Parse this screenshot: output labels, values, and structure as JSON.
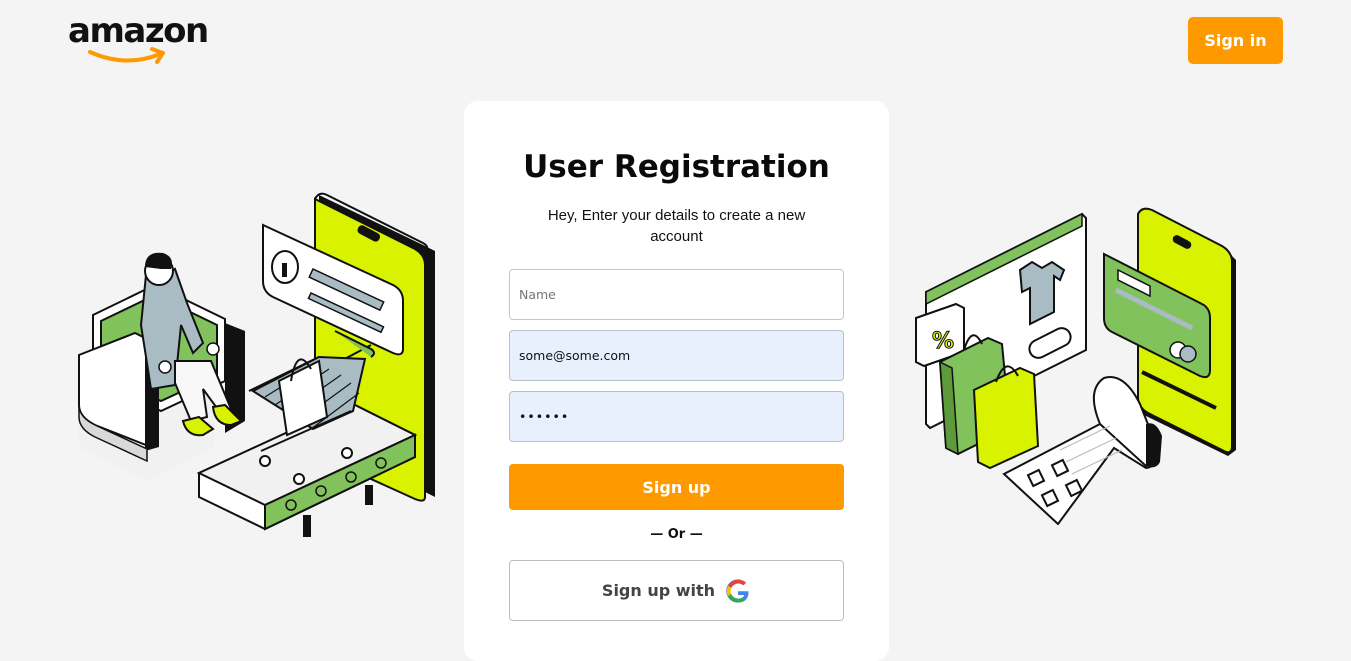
{
  "header": {
    "logo_text": "amazon",
    "signin_label": "Sign in"
  },
  "form": {
    "title": "User Registration",
    "subtitle": "Hey, Enter your details to create a new account",
    "name_placeholder": "Name",
    "email_value": "some@some.com",
    "password_value": "••••••",
    "signup_label": "Sign up",
    "divider_label": "— Or —",
    "google_label": "Sign up with"
  },
  "icons": {
    "logo_arrow": "amazon-smile-arrow",
    "google": "google-g-icon"
  },
  "colors": {
    "accent": "#ff9900",
    "lime": "#d9f200",
    "green": "#82c25c",
    "slate": "#a9bcc4",
    "autofill": "#e8f0fe"
  }
}
